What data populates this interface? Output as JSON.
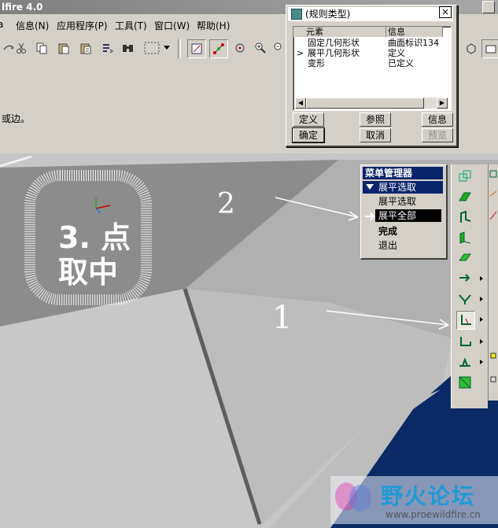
{
  "window": {
    "title": "lfire 4.0"
  },
  "menubar": [
    {
      "label": "信息(N)"
    },
    {
      "label": "应用程序(P)"
    },
    {
      "label": "工具(T)"
    },
    {
      "label": "窗口(W)"
    },
    {
      "label": "帮助(H)"
    }
  ],
  "status": {
    "message": "或边。"
  },
  "dialog": {
    "title": "(规则类型)",
    "close_label": "×",
    "columns": [
      "元素",
      "信息"
    ],
    "rows": [
      {
        "element": "固定几何形状",
        "info": "曲面标识134",
        "current": false
      },
      {
        "element": "展平几何形状",
        "info": "定义",
        "current": true
      },
      {
        "element": "变形",
        "info": "已定义",
        "current": false
      }
    ],
    "buttons": {
      "define": "定义",
      "refer": "参照",
      "info": "信息",
      "ok": "确定",
      "cancel": "取消",
      "preview": "预览"
    }
  },
  "menu_manager": {
    "title": "菜单管理器",
    "section": "展平选取",
    "items": [
      "展平选取",
      "展平全部",
      "完成",
      "退出"
    ],
    "selected": "展平全部"
  },
  "annotations": {
    "label1": "1",
    "label2": "2",
    "label3_line1": "3. 点",
    "label3_line2": "取中"
  },
  "watermark": {
    "text": "野火论坛",
    "url": "www.proewildfire.cn"
  },
  "colors": {
    "menu_title_bg": "#08246b",
    "selected_bg": "#000000",
    "model_surface": "#c4c4c4",
    "viewport_blue": "#0a2a66",
    "watermark_text": "#1f9ad6"
  }
}
